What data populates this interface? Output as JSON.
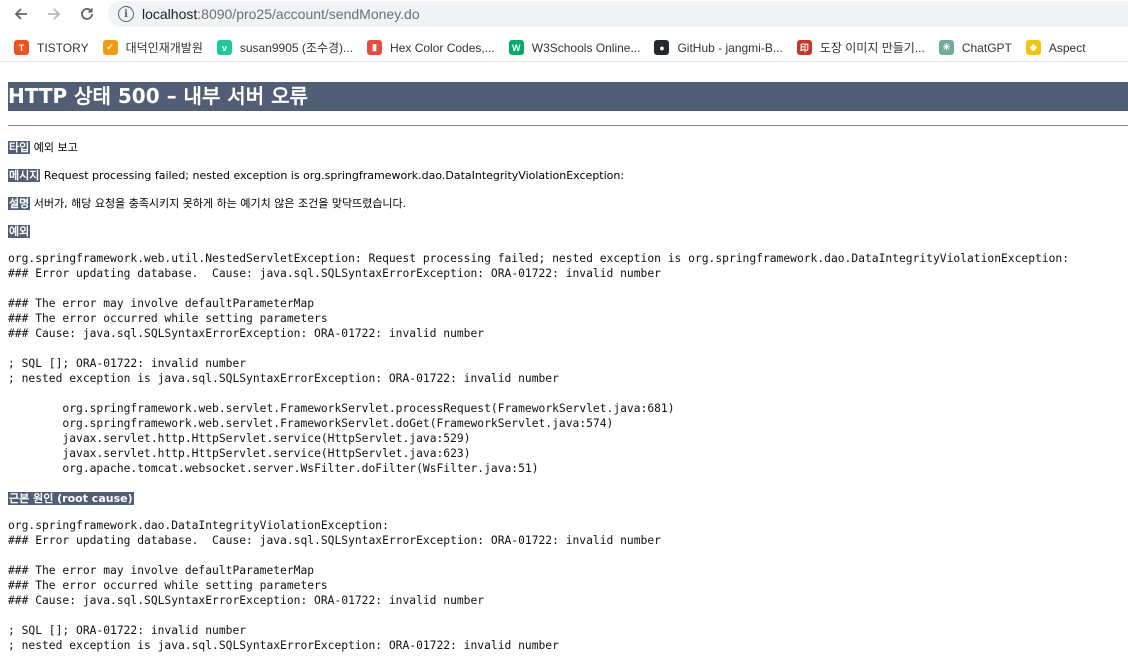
{
  "browser": {
    "url_host": "localhost",
    "url_rest": ":8090/pro25/account/sendMoney.do",
    "bookmarks": [
      {
        "label": "TISTORY",
        "icon": "tistory-icon",
        "color": "#eb531f",
        "glyph": "T"
      },
      {
        "label": "대덕인재개발원",
        "icon": "ddit-icon",
        "color": "#f39c12",
        "glyph": "✓"
      },
      {
        "label": "susan9905 (조수경)...",
        "icon": "velog-icon",
        "color": "#20c997",
        "glyph": "v"
      },
      {
        "label": "Hex Color Codes,...",
        "icon": "hexcolor-icon",
        "color": "#e84c3d",
        "glyph": "▮"
      },
      {
        "label": "W3Schools Online...",
        "icon": "w3schools-icon",
        "color": "#04aa6d",
        "glyph": "W"
      },
      {
        "label": "GitHub - jangmi-B...",
        "icon": "github-icon",
        "color": "#24292f",
        "glyph": "●"
      },
      {
        "label": "도장 이미지 만들기...",
        "icon": "stamp-icon",
        "color": "#c0392b",
        "glyph": "印"
      },
      {
        "label": "ChatGPT",
        "icon": "chatgpt-icon",
        "color": "#74aa9c",
        "glyph": "✳"
      },
      {
        "label": "Aspect",
        "icon": "aspect-icon",
        "color": "#f1c40f",
        "glyph": "◆"
      }
    ]
  },
  "page": {
    "title": "HTTP 상태 500 – 내부 서버 오류",
    "type_label": "타입",
    "type_value": "예외 보고",
    "message_label": "메시지",
    "message_value": "Request processing failed; nested exception is org.springframework.dao.DataIntegrityViolationException:",
    "description_label": "설명",
    "description_value": "서버가, 해당 요청을 충족시키지 못하게 하는 예기치 않은 조건을 맞닥뜨렸습니다.",
    "exception_label": "예외",
    "exception_trace": "org.springframework.web.util.NestedServletException: Request processing failed; nested exception is org.springframework.dao.DataIntegrityViolationException: \n### Error updating database.  Cause: java.sql.SQLSyntaxErrorException: ORA-01722: invalid number\n\n### The error may involve defaultParameterMap\n### The error occurred while setting parameters\n### Cause: java.sql.SQLSyntaxErrorException: ORA-01722: invalid number\n\n; SQL []; ORA-01722: invalid number\n; nested exception is java.sql.SQLSyntaxErrorException: ORA-01722: invalid number\n\n\torg.springframework.web.servlet.FrameworkServlet.processRequest(FrameworkServlet.java:681)\n\torg.springframework.web.servlet.FrameworkServlet.doGet(FrameworkServlet.java:574)\n\tjavax.servlet.http.HttpServlet.service(HttpServlet.java:529)\n\tjavax.servlet.http.HttpServlet.service(HttpServlet.java:623)\n\torg.apache.tomcat.websocket.server.WsFilter.doFilter(WsFilter.java:51)",
    "root_cause_label": "근본 원인 (root cause)",
    "root_cause_trace": "org.springframework.dao.DataIntegrityViolationException: \n### Error updating database.  Cause: java.sql.SQLSyntaxErrorException: ORA-01722: invalid number\n\n### The error may involve defaultParameterMap\n### The error occurred while setting parameters\n### Cause: java.sql.SQLSyntaxErrorException: ORA-01722: invalid number\n\n; SQL []; ORA-01722: invalid number\n; nested exception is java.sql.SQLSyntaxErrorException: ORA-01722: invalid number"
  }
}
